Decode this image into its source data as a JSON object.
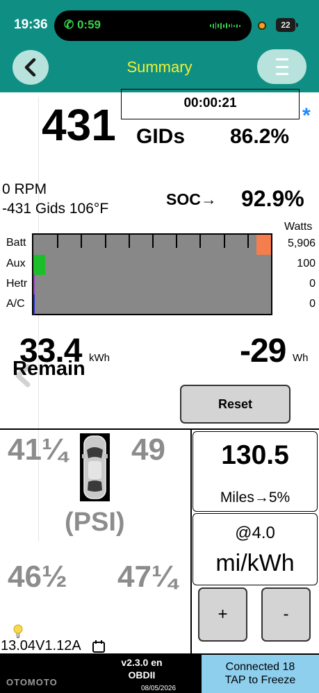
{
  "status_bar": {
    "time": "19:36",
    "call_timer": "0:59",
    "battery_level": "22"
  },
  "nav": {
    "title": "Summary",
    "back_icon": "chevron-left-icon",
    "menu_icon": "hamburger-menu-icon"
  },
  "summary": {
    "gids": "431",
    "elapsed": "00:00:21",
    "indicator": "*",
    "gids_label": "GIDs",
    "gids_percent": "86.2%",
    "rpm": "0 RPM",
    "gids_temp": "-431 Gids 106°F",
    "soc_label": "SOC→",
    "soc_value": "92.9%"
  },
  "power": {
    "unit_label": "Watts",
    "rows": [
      {
        "label": "Batt",
        "value": "5,906",
        "fraction": 0.06,
        "side": "right",
        "color": "#f47e4e"
      },
      {
        "label": "Aux",
        "value": "100",
        "fraction": 0.05,
        "side": "left",
        "color": "#1cbf2a"
      },
      {
        "label": "Hetr",
        "value": "0",
        "fraction": 0.0,
        "side": "left",
        "color": "#9b3fc9"
      },
      {
        "label": "A/C",
        "value": "0",
        "fraction": 0.0,
        "side": "left",
        "color": "#2a2fd6"
      }
    ]
  },
  "energy": {
    "remaining_value": "33.4",
    "remaining_unit": "kWh",
    "remaining_label": "Remain",
    "used_value": "-29",
    "used_unit": "Wh",
    "reset_label": "Reset"
  },
  "tires": {
    "front_left": "41¼",
    "front_right": "49",
    "rear_left": "46½",
    "rear_right": "47¼",
    "unit_label": "(PSI)"
  },
  "range": {
    "miles": "130.5",
    "miles_label": "Miles→5%",
    "efficiency_at": "@4.0",
    "efficiency_unit": "mi/kWh",
    "plus_label": "+",
    "minus_label": "-"
  },
  "footer": {
    "voltage_current": "13.04V1.12A",
    "version_line1": "v2.3.0 en",
    "version_line2": "OBDII",
    "date": "08/05/2026",
    "connected_line1": "Connected 18",
    "connected_line2": "TAP to Freeze",
    "watermark": "OTOMOTO"
  },
  "colors": {
    "header_bg": "#0f8f84",
    "title_text": "#f4f032",
    "accent_star": "#1e88ff",
    "connected_bg": "#8fcfee"
  }
}
